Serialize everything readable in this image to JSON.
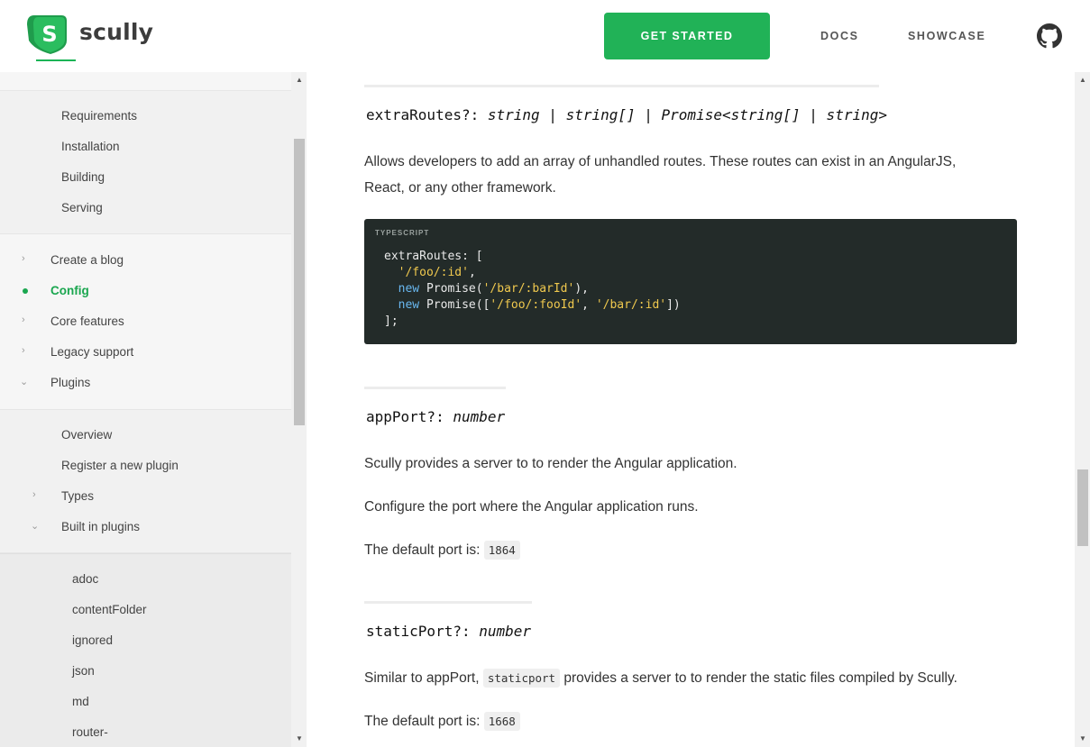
{
  "header": {
    "logo_text": "scully",
    "get_started": "GET STARTED",
    "nav": {
      "docs": "DOCS",
      "showcase": "SHOWCASE"
    }
  },
  "sidebar": {
    "group1": [
      "Requirements",
      "Installation",
      "Building",
      "Serving"
    ],
    "top_items": [
      {
        "label": "Create a blog",
        "state": "collapsed"
      },
      {
        "label": "Config",
        "state": "active"
      },
      {
        "label": "Core features",
        "state": "collapsed"
      },
      {
        "label": "Legacy support",
        "state": "collapsed"
      },
      {
        "label": "Plugins",
        "state": "expanded"
      }
    ],
    "plugins_items": [
      {
        "label": "Overview"
      },
      {
        "label": "Register a new plugin"
      },
      {
        "label": "Types",
        "state": "collapsed"
      },
      {
        "label": "Built in plugins",
        "state": "expanded"
      }
    ],
    "builtin_items": [
      "adoc",
      "contentFolder",
      "ignored",
      "json",
      "md",
      "router-"
    ]
  },
  "main": {
    "extra_routes": {
      "name": "extraRoutes?:",
      "type": "string | string[] | Promise<string[] | string>",
      "desc_line1": "Allows developers to add an array of unhandled routes. These routes can exist in an AngularJS,",
      "desc_line2": "React, or any other framework.",
      "code": {
        "lang": "TYPESCRIPT",
        "l1": "extraRoutes: [",
        "l2_str": "'/foo/:id'",
        "l2_rest": ",",
        "l3_kw": "new",
        "l3_fn": " Promise(",
        "l3_str": "'/bar/:barId'",
        "l3_end": "),",
        "l4_kw": "new",
        "l4_fn": " Promise([",
        "l4_str1": "'/foo/:fooId'",
        "l4_sep": ", ",
        "l4_str2": "'/bar/:id'",
        "l4_end": "])",
        "l5": "];"
      }
    },
    "app_port": {
      "name": "appPort?:",
      "type": "number",
      "p1": "Scully provides a server to to render the Angular application.",
      "p2": "Configure the port where the Angular application runs.",
      "p3_prefix": "The default port is:",
      "p3_value": "1864"
    },
    "static_port": {
      "name": "staticPort?:",
      "type": "number",
      "p1_prefix": "Similar to appPort,",
      "p1_code": "staticport",
      "p1_suffix": "provides a server to to render the static files compiled by Scully.",
      "p2_prefix": "The default port is:",
      "p2_value": "1668"
    }
  },
  "colors": {
    "brand": "#21b257",
    "code_bg": "#232b29",
    "string": "#f0c94e",
    "keyword": "#69b8f0"
  }
}
